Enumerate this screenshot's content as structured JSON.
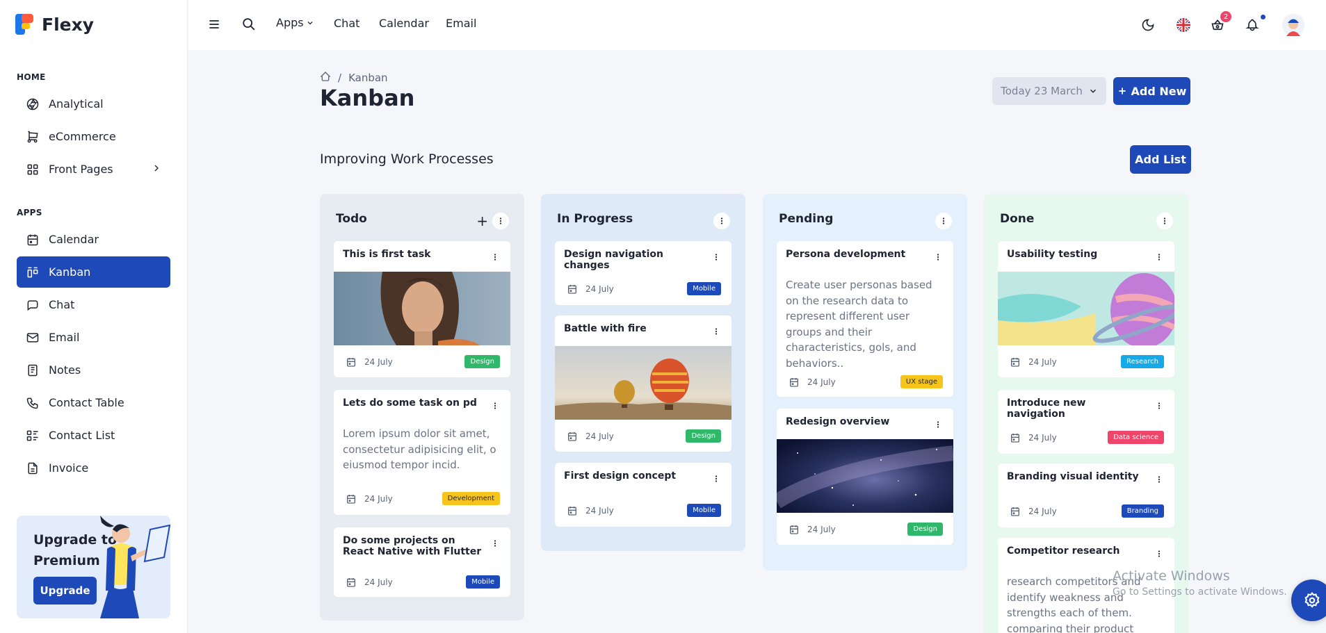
{
  "app": {
    "name": "Flexy"
  },
  "sidebar": {
    "sections": [
      {
        "label": "HOME"
      },
      {
        "label": "APPS"
      }
    ],
    "home_items": [
      {
        "label": "Analytical",
        "icon": "aperture-icon"
      },
      {
        "label": "eCommerce",
        "icon": "cart-icon"
      },
      {
        "label": "Front Pages",
        "icon": "grid-icon"
      }
    ],
    "app_items": [
      {
        "label": "Calendar",
        "icon": "calendar-icon"
      },
      {
        "label": "Kanban",
        "icon": "kanban-icon",
        "active": true
      },
      {
        "label": "Chat",
        "icon": "chat-icon"
      },
      {
        "label": "Email",
        "icon": "mail-icon"
      },
      {
        "label": "Notes",
        "icon": "notes-icon"
      },
      {
        "label": "Contact Table",
        "icon": "phone-icon"
      },
      {
        "label": "Contact List",
        "icon": "list-details-icon"
      },
      {
        "label": "Invoice",
        "icon": "invoice-icon"
      }
    ],
    "upgrade": {
      "title": "Upgrade to Premium",
      "button": "Upgrade"
    }
  },
  "header": {
    "nav": [
      "Apps",
      "Chat",
      "Calendar",
      "Email"
    ],
    "cart_count": "2"
  },
  "page": {
    "breadcrumb": "Kanban",
    "title": "Kanban",
    "date_button": "Today 23 March",
    "add_new": "Add New",
    "board_title": "Improving Work Processes",
    "add_list": "Add List"
  },
  "columns": [
    {
      "title": "Todo",
      "cards": [
        {
          "title": "This is first task",
          "image": "portrait",
          "date": "24 July",
          "tag": "Design",
          "tag_color": "#2fb86a"
        },
        {
          "title": "Lets do some task on pd",
          "desc": "Lorem ipsum dolor sit amet, consectetur adipisicing elit, o eiusmod tempor incid.",
          "date": "24 July",
          "tag": "Development",
          "tag_color": "#f7c41b"
        },
        {
          "title": "Do some projects on React Native with Flutter",
          "date": "24 July",
          "tag": "Mobile",
          "tag_color": "#1e49b8"
        }
      ]
    },
    {
      "title": "In Progress",
      "cards": [
        {
          "title": "Design navigation changes",
          "date": "24 July",
          "tag": "Mobile",
          "tag_color": "#1e49b8"
        },
        {
          "title": "Battle with fire",
          "image": "balloons",
          "date": "24 July",
          "tag": "Design",
          "tag_color": "#2fb86a"
        },
        {
          "title": "First design concept",
          "date": "24 July",
          "tag": "Mobile",
          "tag_color": "#1e49b8"
        }
      ]
    },
    {
      "title": "Pending",
      "cards": [
        {
          "title": "Persona development",
          "desc": "Create user personas based on the research data to represent different user groups and their characteristics, gols, and behaviors..",
          "date": "24 July",
          "tag": "UX stage",
          "tag_color": "#f7c41b"
        },
        {
          "title": "Redesign overview",
          "image": "galaxy",
          "date": "24 July",
          "tag": "Design",
          "tag_color": "#2fb86a"
        }
      ]
    },
    {
      "title": "Done",
      "cards": [
        {
          "title": "Usability testing",
          "image": "abstract",
          "date": "24 July",
          "tag": "Research",
          "tag_color": "#17a8e8"
        },
        {
          "title": "Introduce new navigation",
          "date": "24 July",
          "tag": "Data science",
          "tag_color": "#f0456b"
        },
        {
          "title": "Branding visual identity",
          "date": "24 July",
          "tag": "Branding",
          "tag_color": "#1e49b8"
        },
        {
          "title": "Competitor research",
          "desc": "research competitors and identify weakness and strengths each of them. comparing their product features, quelity..."
        }
      ]
    }
  ],
  "overlay": {
    "activate_title": "Activate Windows",
    "activate_sub": "Go to Settings to activate Windows."
  },
  "colors": {
    "primary": "#1e49b8"
  }
}
